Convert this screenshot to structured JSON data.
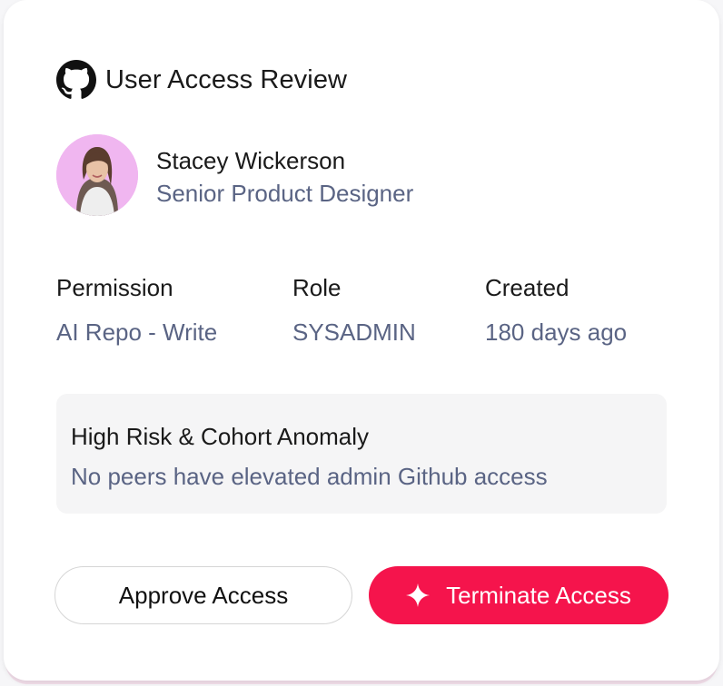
{
  "card": {
    "title": "User Access Review",
    "icon": "github-icon"
  },
  "user": {
    "name": "Stacey Wickerson",
    "job_title": "Senior Product Designer",
    "avatar_bg": "#f0b6f0"
  },
  "details": {
    "permission_label": "Permission",
    "permission_value": "AI Repo - Write",
    "role_label": "Role",
    "role_value": "SYSADMIN",
    "created_label": "Created",
    "created_value": "180 days ago"
  },
  "alert": {
    "title": "High Risk & Cohort Anomaly",
    "description": "No peers have elevated admin Github access"
  },
  "actions": {
    "approve_label": "Approve Access",
    "terminate_label": "Terminate Access",
    "terminate_icon": "sparkle-icon",
    "terminate_color": "#f5144c"
  }
}
